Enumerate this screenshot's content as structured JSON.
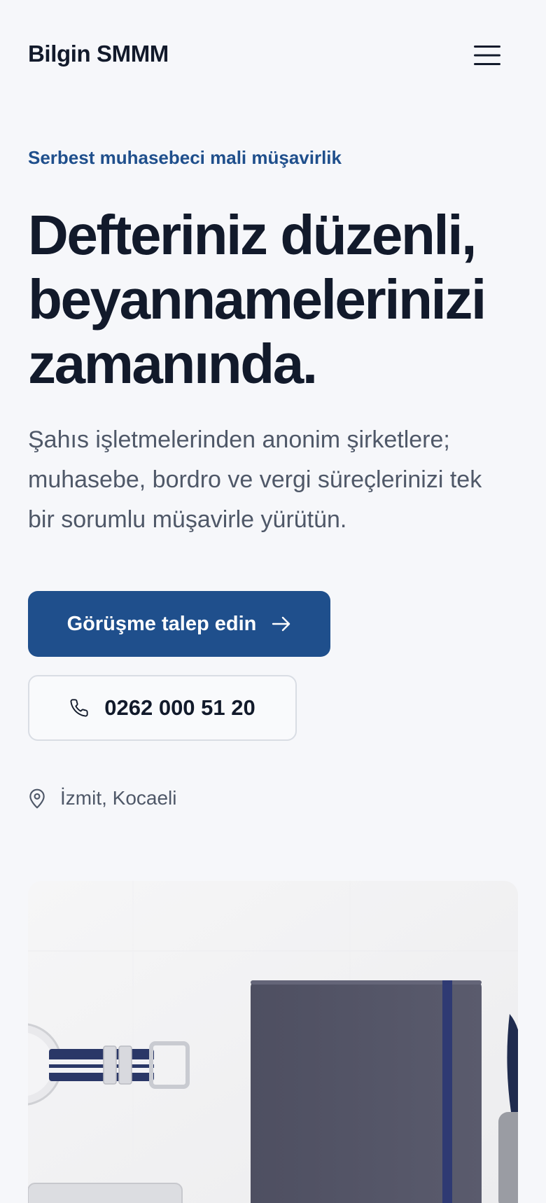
{
  "header": {
    "brand": "Bilgin SMMM",
    "menu_icon": "hamburger-menu-icon"
  },
  "hero": {
    "eyebrow": "Serbest muhasebeci mali müşavirlik",
    "headline_lines": [
      "Defteriniz düzenli,",
      "beyannamelerinizi",
      "zamanında."
    ],
    "lede_lines": [
      "Şahıs işletmelerinden anonim şirketlere;",
      "muhasebe, bordro ve vergi süreçlerinizi tek",
      "bir sorumlu müşavirle yürütün."
    ],
    "primary_cta": {
      "label": "Görüşme talep edin",
      "icon": "arrow-right-icon"
    },
    "phone_cta": {
      "label": "0262 000 51 20",
      "icon": "phone-icon"
    },
    "location": {
      "label": "İzmit, Kocaeli",
      "icon": "map-pin-icon"
    }
  },
  "photo": {
    "subject": [
      "wristwatch",
      "notebook"
    ]
  },
  "colors": {
    "background": "#f6f7fa",
    "accent": "#1f4f8c",
    "text": "#121a2b",
    "muted": "#4f5868"
  }
}
